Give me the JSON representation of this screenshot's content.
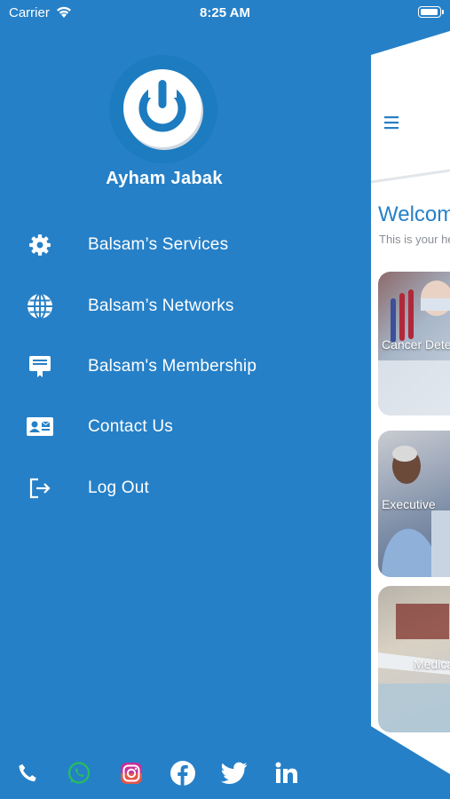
{
  "status_bar": {
    "carrier": "Carrier",
    "time": "8:25 AM"
  },
  "profile": {
    "name": "Ayham Jabak",
    "logo_icon": "power-logo-icon"
  },
  "menu": [
    {
      "label": "Balsam’s Services",
      "icon": "gear-icon"
    },
    {
      "label": "Balsam’s Networks",
      "icon": "globe-icon"
    },
    {
      "label": "Balsam's Membership",
      "icon": "membership-icon"
    },
    {
      "label": "Contact Us",
      "icon": "contact-card-icon"
    },
    {
      "label": "Log Out",
      "icon": "logout-icon"
    }
  ],
  "social": [
    "phone-icon",
    "whatsapp-icon",
    "instagram-icon",
    "facebook-icon",
    "twitter-icon",
    "linkedin-icon"
  ],
  "preview": {
    "welcome": "Welcom",
    "subtitle": "This is your he",
    "cards": [
      "Cancer Dete",
      "Executive",
      "Medica"
    ]
  },
  "colors": {
    "background": "#2680c7",
    "accent": "#1d7bc0",
    "panel": "#ffffff"
  }
}
